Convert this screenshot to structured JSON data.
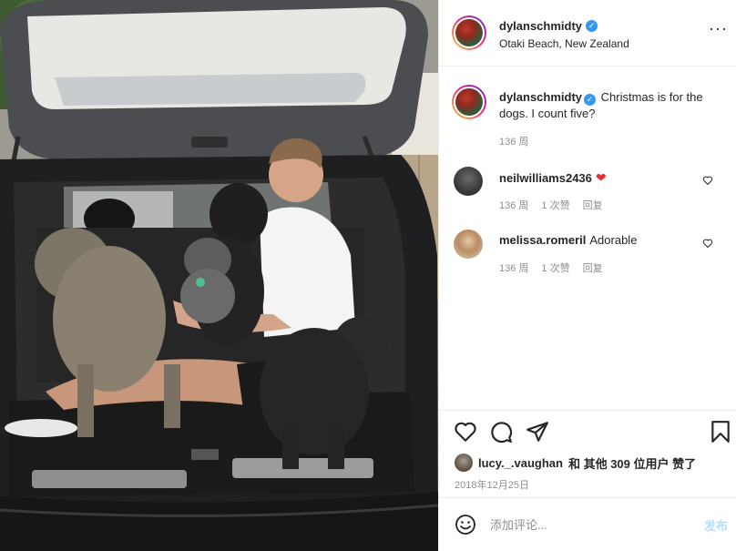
{
  "post": {
    "username": "dylanschmidty",
    "location": "Otaki Beach, New Zealand",
    "more_icon": "more-dots-icon",
    "caption": "Christmas is for the dogs. I count five?",
    "caption_time": "136 周",
    "image_icon": "post-photo"
  },
  "comments": [
    {
      "username": "neilwilliams2436",
      "text": "❤",
      "time": "136 周",
      "likes": "1 次赞",
      "reply": "回复"
    },
    {
      "username": "melissa.romeril",
      "text": "Adorable",
      "time": "136 周",
      "likes": "1 次赞",
      "reply": "回复"
    }
  ],
  "actions": {
    "like_icon": "heart-icon",
    "comment_icon": "comment-icon",
    "share_icon": "share-icon",
    "save_icon": "bookmark-icon",
    "liked_by_user": "lucy._.vaughan",
    "liked_by_rest": "和 其他 309 位用户 赞了",
    "date": "2018年12月25日"
  },
  "add_comment": {
    "emoji_icon": "emoji-icon",
    "placeholder": "添加评论...",
    "post_label": "发布"
  },
  "colors": {
    "accent_blue": "#3897f0",
    "post_disabled": "#b2dffc",
    "heart_red": "#ed2b2b",
    "muted_text": "#8e8e8e"
  }
}
